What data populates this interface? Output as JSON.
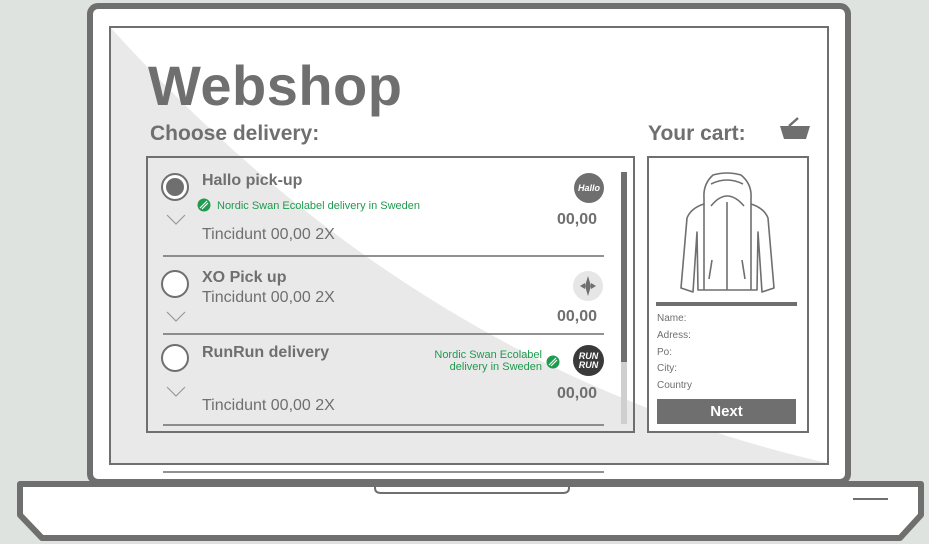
{
  "shop": {
    "title": "Webshop",
    "subtitle": "Choose delivery:"
  },
  "options": [
    {
      "name": "Hallo pick-up",
      "eco_label": "Nordic Swan Ecolabel delivery in Sweden",
      "details": "Tincidunt 00,00 2X",
      "price": "00,00",
      "logo_text": "Hallo",
      "selected": true
    },
    {
      "name": "XO Pick up",
      "details": "Tincidunt 00,00 2X",
      "price": "00,00",
      "selected": false
    },
    {
      "name": "RunRun delivery",
      "eco_label_line1": "Nordic Swan Ecolabel",
      "eco_label_line2": "delivery in Sweden",
      "details": "Tincidunt 00,00 2X",
      "price": "00,00",
      "logo_line1": "RUN",
      "logo_line2": "RUN",
      "selected": false
    }
  ],
  "cart": {
    "title": "Your cart:",
    "fields": [
      "Name:",
      "Adress:",
      "Po:",
      "City:",
      "Country"
    ],
    "next_label": "Next"
  },
  "colors": {
    "text": "#6f6f6f",
    "eco_green": "#1f9a4f",
    "background": "#dfe3df"
  }
}
